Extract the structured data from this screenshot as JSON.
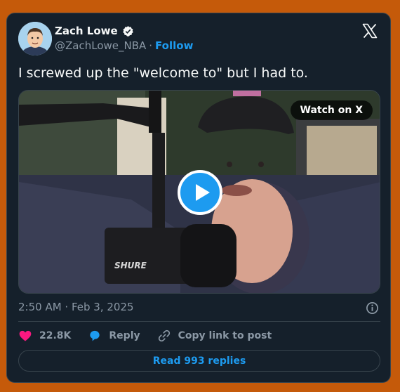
{
  "author": {
    "name": "Zach Lowe",
    "handle": "@ZachLowe_NBA",
    "separator": "·",
    "follow_label": "Follow",
    "verified_icon": "verified-badge-icon"
  },
  "brand_icon": "x-logo-icon",
  "tweet": {
    "text": "I screwed up the \"welcome to\" but I had to.",
    "timestamp": "2:50 AM · Feb 3, 2025"
  },
  "media": {
    "watch_label": "Watch on X",
    "play_icon": "play-icon",
    "mic_brand": "SHURE"
  },
  "actions": {
    "likes": "22.8K",
    "reply_label": "Reply",
    "copy_label": "Copy link to post"
  },
  "read_replies_label": "Read 993 replies",
  "colors": {
    "accent": "#1d9bf0",
    "like": "#f91880",
    "card_bg": "#15202b",
    "page_bg": "#c55a0a"
  }
}
